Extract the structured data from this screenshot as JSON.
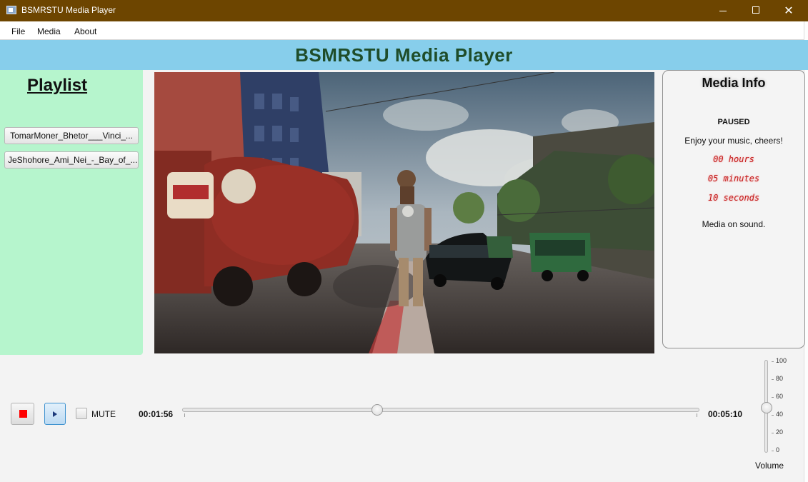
{
  "window": {
    "title": "BSMRSTU Media Player",
    "minimize_glyph": "",
    "maximize_glyph": "",
    "close_glyph": "✕"
  },
  "menu": {
    "items": [
      "File",
      "Media",
      "About"
    ]
  },
  "header": {
    "title": "BSMRSTU Media Player",
    "background": "#87ceeb",
    "title_color": "#1f4d2a"
  },
  "playlist": {
    "title": "Playlist",
    "items": [
      "TomarMoner_Bhetor___Vinci_...",
      "JeShohore_Ami_Nei_-_Bay_of_..."
    ],
    "background": "#b6f5cd"
  },
  "media_info": {
    "title": "Media Info",
    "status": "PAUSED",
    "message": "Enjoy your music, cheers!",
    "hours": "00 hours",
    "minutes": "05 minutes",
    "seconds": "10 seconds",
    "sound": "Media on sound."
  },
  "controls": {
    "stop_icon": "stop-icon",
    "play_icon": "play-icon",
    "mute_label": "MUTE",
    "mute_checked": false,
    "current_time": "00:01:56",
    "total_time": "00:05:10",
    "progress_fraction": 0.374
  },
  "volume": {
    "label": "Volume",
    "value": 48,
    "ticks": [
      "100",
      "80",
      "60",
      "40",
      "20",
      "0"
    ]
  },
  "icons": {
    "window": "app-window-icon",
    "stop": "stop-icon",
    "play": "play-icon"
  },
  "colors": {
    "titlebar": "#6d4500",
    "time_red": "#c41a1a",
    "stop_red": "#ff0000"
  }
}
